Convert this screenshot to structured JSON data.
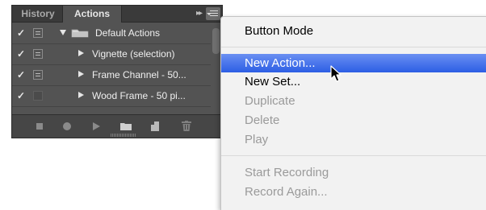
{
  "panel": {
    "tabs": [
      {
        "label": "History"
      },
      {
        "label": "Actions"
      }
    ],
    "collapse_glyph": "▸▸",
    "rows": [
      {
        "check": "✓",
        "label": "Default Actions",
        "type": "set"
      },
      {
        "check": "✓",
        "label": "Vignette (selection)",
        "type": "action"
      },
      {
        "check": "✓",
        "label": "Frame Channel - 50...",
        "type": "action"
      },
      {
        "check": "✓",
        "label": "Wood Frame - 50 pi...",
        "type": "action"
      }
    ],
    "bottom_icons": [
      "stop-icon",
      "record-icon",
      "play-icon",
      "new-set-icon",
      "new-action-icon",
      "trash-icon"
    ]
  },
  "menu": {
    "items": [
      {
        "label": "Button Mode",
        "state": "normal"
      },
      {
        "label": "New Action...",
        "state": "highlighted"
      },
      {
        "label": "New Set...",
        "state": "normal"
      },
      {
        "label": "Duplicate",
        "state": "disabled"
      },
      {
        "label": "Delete",
        "state": "disabled"
      },
      {
        "label": "Play",
        "state": "disabled"
      },
      {
        "label": "Start Recording",
        "state": "disabled"
      },
      {
        "label": "Record Again...",
        "state": "disabled"
      }
    ]
  },
  "colors": {
    "panel_bg": "#535353",
    "tabbar_bg": "#3a3a3a",
    "menu_bg": "#f2f2f2",
    "highlight": "#2c5ee4",
    "disabled_text": "#9a9a9a"
  }
}
